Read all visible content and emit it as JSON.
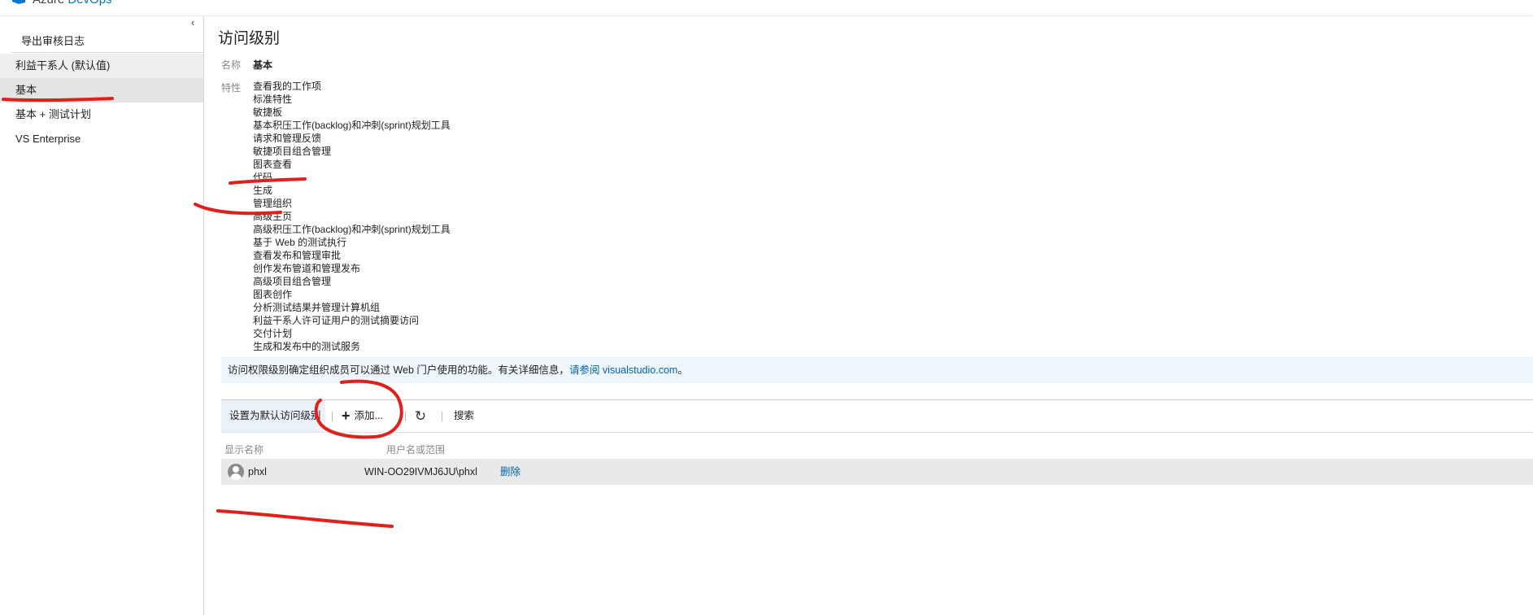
{
  "app": {
    "brand_1": "Azure",
    "brand_2": "DevOps"
  },
  "sidebar": {
    "collapse_glyph": "‹",
    "export_label": "导出审核日志",
    "items": [
      {
        "label": "利益干系人 (默认值)"
      },
      {
        "label": "基本"
      },
      {
        "label": "基本 + 测试计划"
      },
      {
        "label": "VS Enterprise"
      }
    ],
    "selected_index": 1
  },
  "main": {
    "title": "访问级别",
    "name_label": "名称",
    "name_value": "基本",
    "features_label": "特性",
    "features": [
      "查看我的工作项",
      "标准特性",
      "敏捷板",
      "基本积压工作(backlog)和冲刺(sprint)规划工具",
      "请求和管理反馈",
      "敏捷项目组合管理",
      "图表查看",
      "代码",
      "生成",
      "管理组织",
      "高级主页",
      "高级积压工作(backlog)和冲刺(sprint)规划工具",
      "基于 Web 的测试执行",
      "查看发布和管理审批",
      "创作发布管道和管理发布",
      "高级项目组合管理",
      "图表创作",
      "分析测试结果并管理计算机组",
      "利益干系人许可证用户的测试摘要访问",
      "交付计划",
      "生成和发布中的测试服务"
    ],
    "info_text": "访问权限级别确定组织成员可以通过 Web 门户使用的功能。有关详细信息，",
    "info_link": "请参阅 visualstudio.com",
    "info_end": "。"
  },
  "toolbar": {
    "set_default_label": "设置为默认访问级别",
    "add_label": "添加...",
    "refresh_glyph": "↻",
    "search_label": "搜索"
  },
  "table": {
    "headers": [
      "显示名称",
      "用户名或范围"
    ],
    "rows": [
      {
        "display_name": "phxl",
        "username": "WIN-OO29IVMJ6JU\\phxl",
        "action": "删除"
      }
    ]
  },
  "colors": {
    "accent": "#0078d4",
    "link": "#0063b1",
    "annotation": "#e0201c",
    "info_bg": "#eff6fc"
  },
  "icons": [
    "azure-devops-logo-icon",
    "chevron-left-icon",
    "plus-icon",
    "refresh-icon",
    "user-avatar-icon"
  ]
}
